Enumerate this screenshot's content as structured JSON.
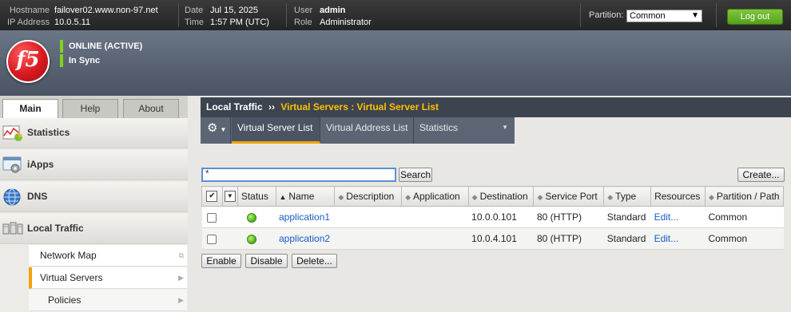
{
  "header": {
    "hostname_label": "Hostname",
    "hostname": "failover02.www.non-97.net",
    "ip_label": "IP Address",
    "ip": "10.0.5.11",
    "date_label": "Date",
    "date": "Jul 15, 2025",
    "time_label": "Time",
    "time": "1:57 PM (UTC)",
    "user_label": "User",
    "user": "admin",
    "role_label": "Role",
    "role": "Administrator",
    "partition_label": "Partition:",
    "partition_value": "Common",
    "logout_label": "Log out"
  },
  "banner": {
    "logo_text": "f5",
    "status_online": "ONLINE (ACTIVE)",
    "status_sync": "In Sync",
    "status_color": "#7ed321"
  },
  "nav_tabs": [
    {
      "label": "Main",
      "active": true
    },
    {
      "label": "Help",
      "active": false
    },
    {
      "label": "About",
      "active": false
    }
  ],
  "sidebar": {
    "sections": [
      {
        "label": "Statistics",
        "icon": "statistics-chart-icon"
      },
      {
        "label": "iApps",
        "icon": "iapps-gear-icon"
      },
      {
        "label": "DNS",
        "icon": "dns-globe-icon"
      },
      {
        "label": "Local Traffic",
        "icon": "local-traffic-servers-icon"
      }
    ],
    "subitems": [
      {
        "label": "Network Map",
        "selected": false
      },
      {
        "label": "Virtual Servers",
        "selected": true
      },
      {
        "label": "Policies",
        "selected": false
      }
    ]
  },
  "breadcrumb": {
    "section": "Local Traffic",
    "separator": "››",
    "path": "Virtual Servers : Virtual Server List"
  },
  "subtabs": [
    {
      "label": "Virtual Server List",
      "active": true
    },
    {
      "label": "Virtual Address List",
      "active": false
    },
    {
      "label": "Statistics",
      "active": false,
      "has_dropdown": true
    }
  ],
  "search": {
    "value": "*",
    "button_label": "Search"
  },
  "create_button_label": "Create...",
  "table": {
    "headers": [
      "Status",
      "Name",
      "Description",
      "Application",
      "Destination",
      "Service Port",
      "Type",
      "Resources",
      "Partition / Path"
    ],
    "rows": [
      {
        "status": "available",
        "name": "application1",
        "description": "",
        "application": "",
        "destination": "10.0.0.101",
        "service_port": "80 (HTTP)",
        "type": "Standard",
        "resources": "Edit...",
        "partition": "Common"
      },
      {
        "status": "available",
        "name": "application2",
        "description": "",
        "application": "",
        "destination": "10.0.4.101",
        "service_port": "80 (HTTP)",
        "type": "Standard",
        "resources": "Edit...",
        "partition": "Common"
      }
    ]
  },
  "actions": {
    "enable": "Enable",
    "disable": "Disable",
    "delete": "Delete..."
  },
  "colors": {
    "accent": "#f0a30a",
    "logout_green": "#55a01c",
    "link_blue": "#1a5cc8",
    "brand_red": "#d71920"
  }
}
